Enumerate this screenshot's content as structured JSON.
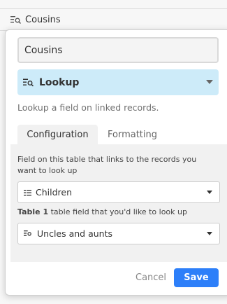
{
  "column": {
    "name": "Cousins",
    "icon": "lookup-icon"
  },
  "field_dialog": {
    "field_name_value": "Cousins",
    "field_type": {
      "label": "Lookup",
      "icon": "lookup-icon"
    },
    "description": "Lookup a field on linked records.",
    "tabs": [
      {
        "label": "Configuration",
        "active": true
      },
      {
        "label": "Formatting",
        "active": false
      }
    ],
    "link_field_label": "Field on this table that links to the records you want to look up",
    "link_field_value": "Children",
    "link_field_icon": "linked-records-icon",
    "lookup_field_label_bold": "Table 1",
    "lookup_field_label_rest": " table field that you'd like to look up",
    "lookup_field_value": "Uncles and aunts",
    "lookup_field_icon": "lookup-icon",
    "cancel_label": "Cancel",
    "save_label": "Save"
  },
  "colors": {
    "type_select_bg": "#cdebf9",
    "save_button": "#2d7ff9"
  }
}
